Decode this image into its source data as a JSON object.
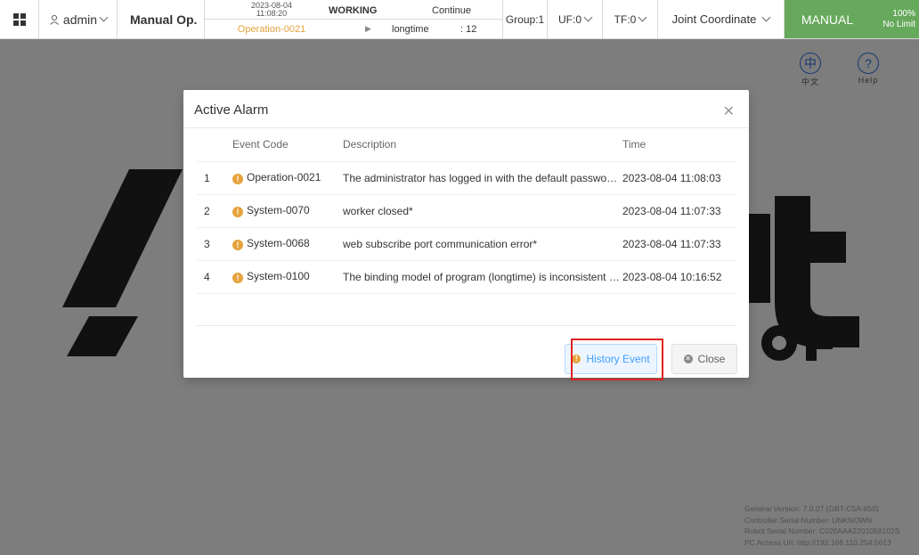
{
  "topbar": {
    "user": "admin",
    "mode_label": "Manual Op.",
    "status": {
      "date": "2023-08-04",
      "time": "11:08:20",
      "state": "WORKING",
      "action": "Continue",
      "event": "Operation-0021",
      "program": "longtime",
      "line": ": 12"
    },
    "group": "Group:1",
    "uf": "UF:0",
    "tf": "TF:0",
    "coordinate": "Joint Coordinate",
    "run_mode": "MANUAL",
    "speed": "100%",
    "speed_limit": "No Limit"
  },
  "side_buttons": {
    "lang_label": "中文",
    "lang_glyph": "中",
    "help_label": "Help",
    "help_glyph": "?"
  },
  "version_info": {
    "general": "General Version:  7.0.07 (GBT-C5A-850)",
    "controller": "Controller Serial Number:  UNKNOWN",
    "robot": "Robot Serial Number:  C020AAA2201058102S",
    "pc_url": "PC Access Url:  http://192.168.110.254:5613"
  },
  "modal": {
    "title": "Active Alarm",
    "columns": [
      "",
      "Event Code",
      "Description",
      "Time"
    ],
    "rows": [
      {
        "index": "1",
        "code": "Operation-0021",
        "description": "The administrator has logged in with the default password. It...",
        "time": "2023-08-04 11:08:03"
      },
      {
        "index": "2",
        "code": "System-0070",
        "description": "worker closed*",
        "time": "2023-08-04 11:07:33"
      },
      {
        "index": "3",
        "code": "System-0068",
        "description": "web subscribe port communication error*",
        "time": "2023-08-04 11:07:33"
      },
      {
        "index": "4",
        "code": "System-0100",
        "description": "The binding model of program (longtime) is inconsistent with...",
        "time": "2023-08-04 10:16:52"
      }
    ],
    "history_button": "History Event",
    "close_button": "Close"
  },
  "colors": {
    "warning": "#e6a23c",
    "manual_green": "#67a95c",
    "primary": "#409eff",
    "highlight": "#e02020"
  }
}
